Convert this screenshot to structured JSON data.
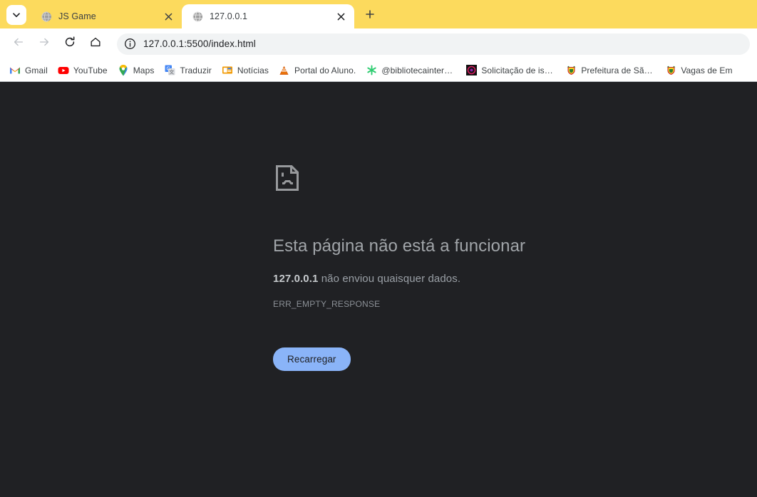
{
  "browser": {
    "tab_search_icon": "chevron-down-icon",
    "new_tab_icon": "plus-icon",
    "tabs": [
      {
        "title": "JS Game",
        "favicon": "globe-icon",
        "close_icon": "close-icon",
        "active": false
      },
      {
        "title": "127.0.0.1",
        "favicon": "globe-icon",
        "close_icon": "close-icon",
        "active": true
      }
    ],
    "toolbar": {
      "back_icon": "back-arrow-icon",
      "forward_icon": "forward-arrow-icon",
      "reload_icon": "reload-icon",
      "home_icon": "home-icon",
      "omnibox": {
        "security_icon": "info-circle-icon",
        "url": "127.0.0.1:5500/index.html"
      }
    },
    "bookmarks": [
      {
        "label": "Gmail",
        "icon": "gmail-icon"
      },
      {
        "label": "YouTube",
        "icon": "youtube-icon"
      },
      {
        "label": "Maps",
        "icon": "maps-pin-icon"
      },
      {
        "label": "Traduzir",
        "icon": "google-translate-icon"
      },
      {
        "label": "Notícias",
        "icon": "google-news-icon"
      },
      {
        "label": "Portal do Aluno.",
        "icon": "orange-cone-icon"
      },
      {
        "label": "@bibliotecainterativ...",
        "icon": "green-asterisk-icon"
      },
      {
        "label": "Solicitação de isenç...",
        "icon": "dark-circle-icon"
      },
      {
        "label": "Prefeitura de São Jo...",
        "icon": "coat-of-arms-icon"
      },
      {
        "label": "Vagas de Em",
        "icon": "coat-of-arms-icon"
      }
    ]
  },
  "error_page": {
    "icon": "sad-page-icon",
    "title": "Esta página não está a funcionar",
    "subject": "127.0.0.1",
    "subtitle_rest": " não enviou quaisquer dados.",
    "code": "ERR_EMPTY_RESPONSE",
    "reload_label": "Recarregar"
  },
  "colors": {
    "tabstrip": "#FCDA5D",
    "page_background": "#202124",
    "button_accent": "#8ab4f8",
    "omnibox_background": "#f1f3f4"
  }
}
